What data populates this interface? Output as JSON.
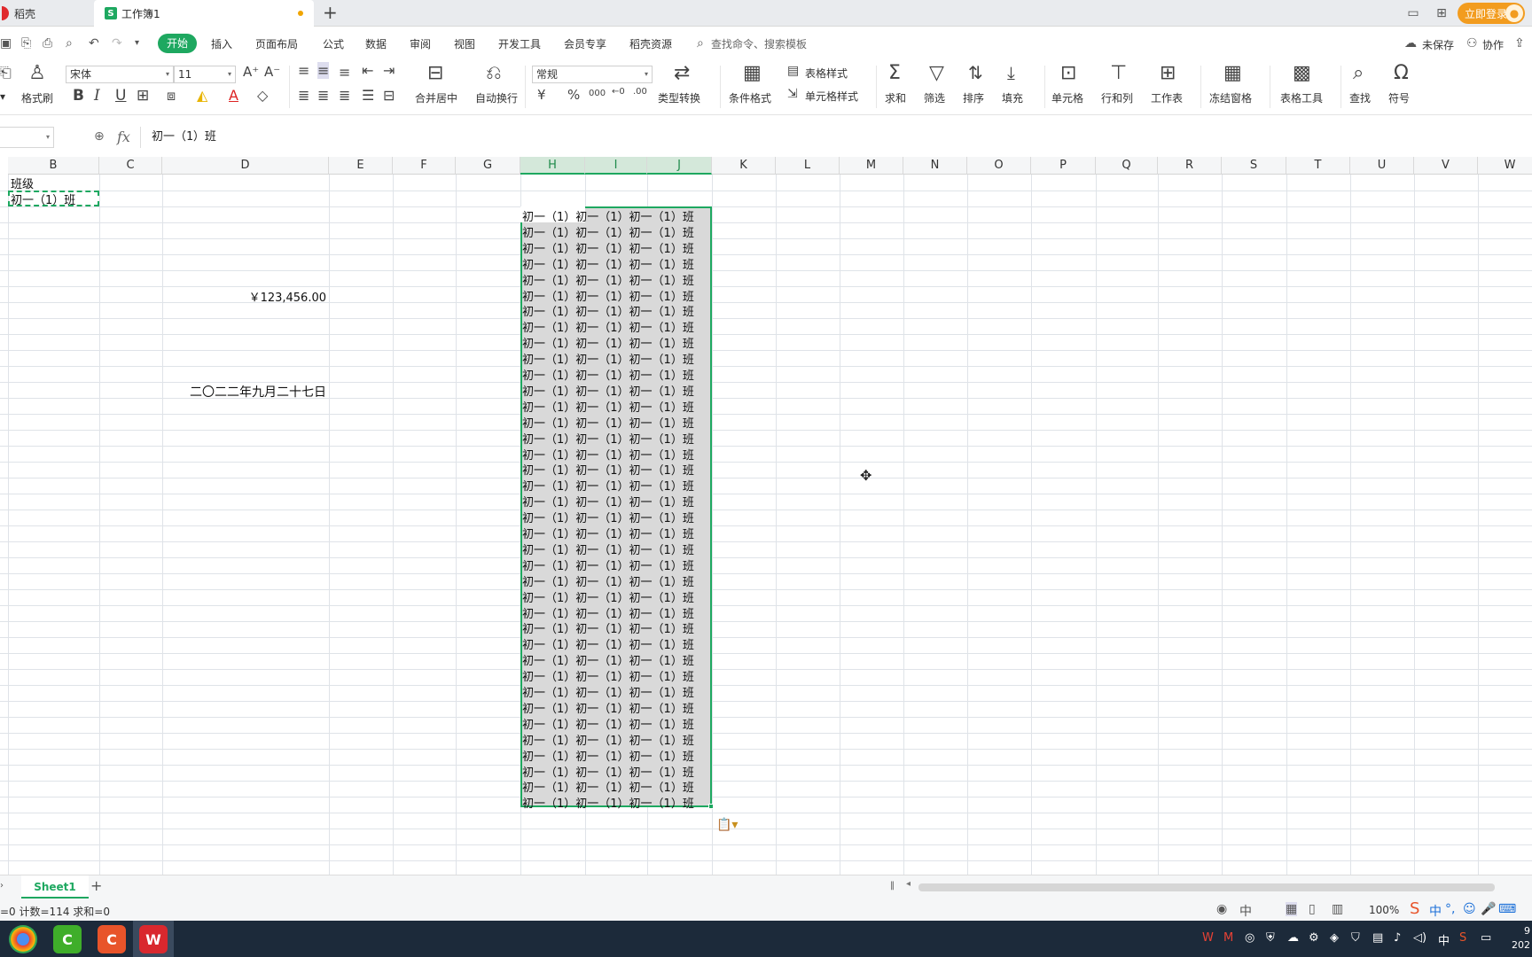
{
  "tabs": [
    {
      "label": "稻壳"
    },
    {
      "label": "工作簿1"
    }
  ],
  "topbar_right": {
    "login_label": "立即登录"
  },
  "menu": {
    "start": "开始",
    "items": [
      "插入",
      "页面布局",
      "公式",
      "数据",
      "审阅",
      "视图",
      "开发工具",
      "会员专享",
      "稻壳资源"
    ],
    "search_placeholder": "查找命令、搜索模板",
    "unsaved": "未保存",
    "collab": "协作"
  },
  "ribbon": {
    "format_painter": "格式刷",
    "font_name": "宋体",
    "font_size": "11",
    "merge_center": "合并居中",
    "auto_wrap": "自动换行",
    "number_format": "常规",
    "currency_symbol": "¥",
    "percent_symbol": "%",
    "type_convert": "类型转换",
    "cond_format": "条件格式",
    "table_style": "表格样式",
    "cell_style": "单元格样式",
    "sum": "求和",
    "filter": "筛选",
    "sort": "排序",
    "fill": "填充",
    "cell": "单元格",
    "row_col": "行和列",
    "worksheet": "工作表",
    "freeze": "冻结窗格",
    "table_tools": "表格工具",
    "find": "查找",
    "symbol": "符号"
  },
  "formula_bar": {
    "fx_label": "fx",
    "value": "初一（1）班"
  },
  "columns": [
    "B",
    "C",
    "D",
    "E",
    "F",
    "G",
    "H",
    "I",
    "J",
    "K",
    "L",
    "M",
    "N",
    "O",
    "P",
    "Q",
    "R",
    "S",
    "T",
    "U",
    "V",
    "W"
  ],
  "cells": {
    "b1": "班级",
    "b2": "初一（1）班",
    "d_currency": "￥123,456.00",
    "d_date": "二〇二二年九月二十七日"
  },
  "selection_rows": [
    "初一（1）初一（1）初一（1）班",
    "初一（1）初一（1）初一（1）班",
    "初一（1）初一（1）初一（1）班",
    "初一（1）初一（1）初一（1）班",
    "初一（1）初一（1）初一（1）班",
    "初一（1）初一（1）初一（1）班",
    "初一（1）初一（1）初一（1）班",
    "初一（1）初一（1）初一（1）班",
    "初一（1）初一（1）初一（1）班",
    "初一（1）初一（1）初一（1）班",
    "初一（1）初一（1）初一（1）班",
    "初一（1）初一（1）初一（1）班",
    "初一（1）初一（1）初一（1）班",
    "初一（1）初一（1）初一（1）班",
    "初一（1）初一（1）初一（1）班",
    "初一（1）初一（1）初一（1）班",
    "初一（1）初一（1）初一（1）班",
    "初一（1）初一（1）初一（1）班",
    "初一（1）初一（1）初一（1）班",
    "初一（1）初一（1）初一（1）班",
    "初一（1）初一（1）初一（1）班",
    "初一（1）初一（1）初一（1）班",
    "初一（1）初一（1）初一（1）班",
    "初一（1）初一（1）初一（1）班",
    "初一（1）初一（1）初一（1）班",
    "初一（1）初一（1）初一（1）班",
    "初一（1）初一（1）初一（1）班",
    "初一（1）初一（1）初一（1）班",
    "初一（1）初一（1）初一（1）班",
    "初一（1）初一（1）初一（1）班",
    "初一（1）初一（1）初一（1）班",
    "初一（1）初一（1）初一（1）班",
    "初一（1）初一（1）初一（1）班",
    "初一（1）初一（1）初一（1）班",
    "初一（1）初一（1）初一（1）班",
    "初一（1）初一（1）初一（1）班",
    "初一（1）初一（1）初一（1）班",
    "初一（1）初一（1）初一（1）班"
  ],
  "sheet_tabs": {
    "active": "Sheet1"
  },
  "status": {
    "text": "=0  计数=114  求和=0",
    "zoom": "100%"
  },
  "taskbar": {
    "ime": "中",
    "year": "202"
  },
  "colors": {
    "accent": "#1ea860",
    "login": "#f29c1f",
    "selection_fill": "#d9d9d9"
  }
}
